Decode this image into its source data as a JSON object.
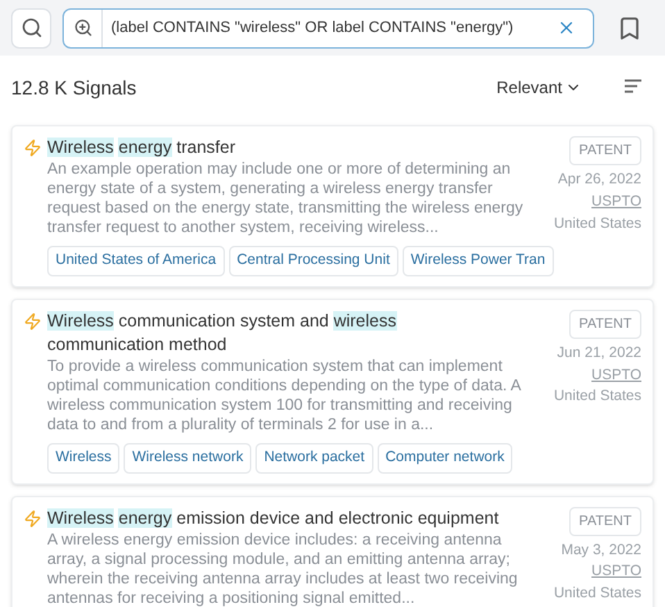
{
  "search": {
    "query": "(label CONTAINS \"wireless\" OR label CONTAINS \"energy\")"
  },
  "results_header": {
    "count": "12.8 K Signals",
    "sort": "Relevant"
  },
  "results": [
    {
      "title": [
        {
          "text": "Wireless",
          "highlighted": true
        },
        {
          "text": "energy",
          "highlighted": true
        },
        {
          "text": "transfer",
          "highlighted": false
        }
      ],
      "abstract": "An example operation may include one or more of determining an energy state of a system, generating a wireless energy transfer request based on the energy state, transmitting the wireless energy transfer request to another system, receiving wireless...",
      "type": "PATENT",
      "date": "Apr 26, 2022",
      "source": "USPTO",
      "country": "United States",
      "tags": [
        "United States of America",
        "Central Processing Unit",
        "Wireless Power Tran"
      ]
    },
    {
      "title": [
        {
          "text": "Wireless",
          "highlighted": true
        },
        {
          "text": "communication system and",
          "highlighted": false
        },
        {
          "text": "wireless",
          "highlighted": true
        },
        {
          "text": "communication method",
          "highlighted": false
        }
      ],
      "abstract": "To provide a wireless communication system that can implement optimal communication conditions depending on the type of data. A wireless communication system 100 for transmitting and receiving data to and from a plurality of terminals 2 for use in a...",
      "type": "PATENT",
      "date": "Jun 21, 2022",
      "source": "USPTO",
      "country": "United States",
      "tags": [
        "Wireless",
        "Wireless network",
        "Network packet",
        "Computer network"
      ]
    },
    {
      "title": [
        {
          "text": "Wireless",
          "highlighted": true
        },
        {
          "text": "energy",
          "highlighted": true
        },
        {
          "text": "emission device and electronic equipment",
          "highlighted": false
        }
      ],
      "abstract": "A wireless energy emission device includes: a receiving antenna array, a signal processing module, and an emitting antenna array; wherein the receiving antenna array includes at least two receiving antennas for receiving a positioning signal emitted...",
      "type": "PATENT",
      "date": "May 3, 2022",
      "source": "USPTO",
      "country": "United States"
    }
  ]
}
